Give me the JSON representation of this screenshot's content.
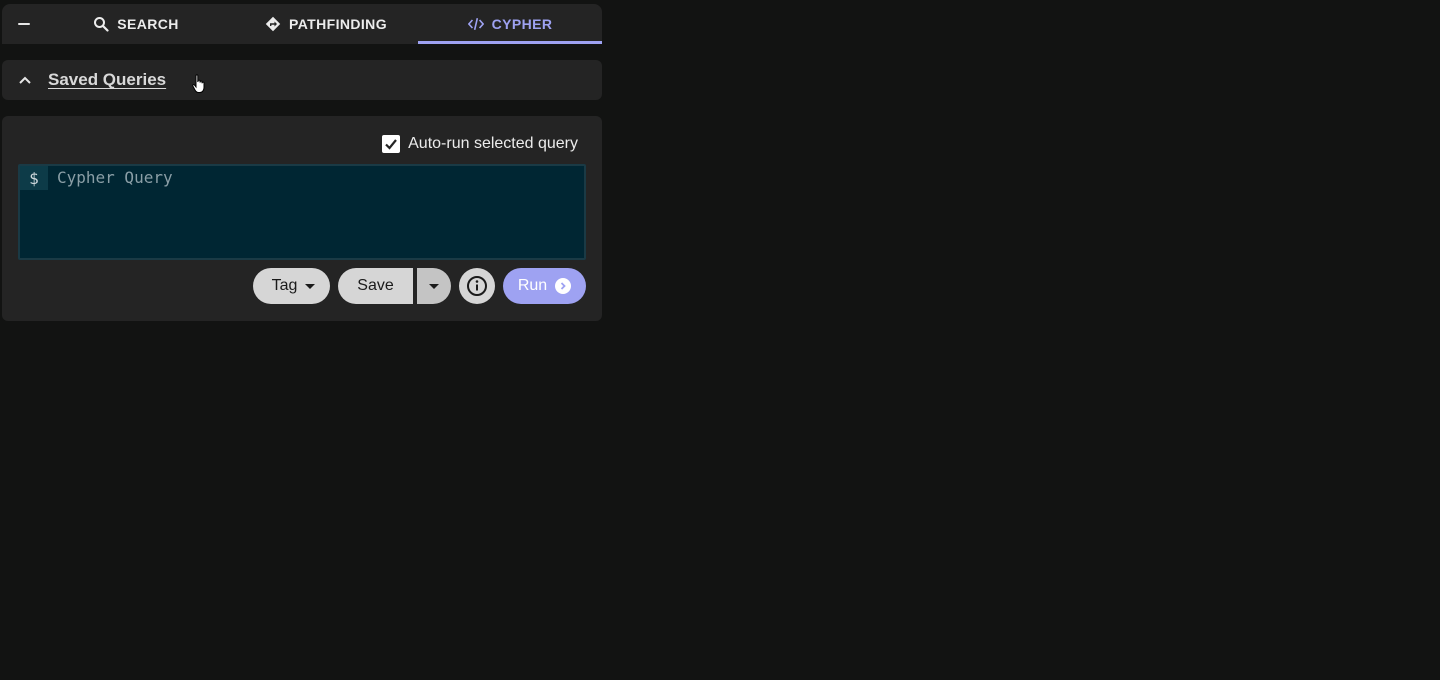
{
  "tabs": {
    "search_label": "SEARCH",
    "pathfinding_label": "PATHFINDING",
    "cypher_label": "CYPHER",
    "active": "CYPHER"
  },
  "saved_queries": {
    "title": "Saved Queries",
    "expanded": false
  },
  "editor": {
    "autorun_label": "Auto-run selected query",
    "autorun_checked": true,
    "prompt": "$",
    "placeholder": "Cypher Query",
    "value": ""
  },
  "actions": {
    "tag_label": "Tag",
    "save_label": "Save",
    "run_label": "Run"
  },
  "colors": {
    "accent": "#9ea2f2",
    "editor_bg": "#002633",
    "panel_bg": "#242424",
    "page_bg": "#121312"
  }
}
